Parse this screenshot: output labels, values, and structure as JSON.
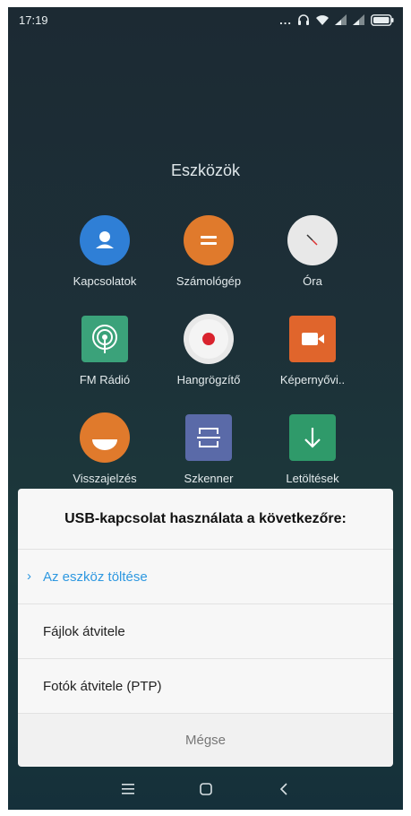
{
  "status_bar": {
    "time": "17:19",
    "dots": "...",
    "colors": {
      "text": "#e8eef0"
    }
  },
  "folder": {
    "title": "Eszközök"
  },
  "apps": [
    {
      "label": "Kapcsolatok",
      "icon": "contacts-icon",
      "color": "#2f7fd6"
    },
    {
      "label": "Számológép",
      "icon": "calculator-icon",
      "color": "#e07a2c"
    },
    {
      "label": "Óra",
      "icon": "clock-icon",
      "color": "#e8e8e8"
    },
    {
      "label": "FM Rádió",
      "icon": "radio-icon",
      "color": "#3ba27a"
    },
    {
      "label": "Hangrögzítő",
      "icon": "recorder-icon",
      "color": "#e8e8e8"
    },
    {
      "label": "Képernyővi..",
      "icon": "screen-recorder-icon",
      "color": "#e0652c"
    },
    {
      "label": "Visszajelzés",
      "icon": "feedback-icon",
      "color": "#e07a2c"
    },
    {
      "label": "Szkenner",
      "icon": "scanner-icon",
      "color": "#5a6aa8"
    },
    {
      "label": "Letöltések",
      "icon": "downloads-icon",
      "color": "#2f9a6a"
    }
  ],
  "dialog": {
    "title": "USB-kapcsolat használata a következőre:",
    "options": [
      {
        "label": "Az eszköz töltése",
        "selected": true
      },
      {
        "label": "Fájlok átvitele",
        "selected": false
      },
      {
        "label": "Fotók átvitele (PTP)",
        "selected": false
      }
    ],
    "cancel_label": "Mégse",
    "colors": {
      "accent": "#2e98e0"
    }
  },
  "nav_bar": {
    "buttons": [
      "menu-icon",
      "home-icon",
      "back-icon"
    ]
  }
}
